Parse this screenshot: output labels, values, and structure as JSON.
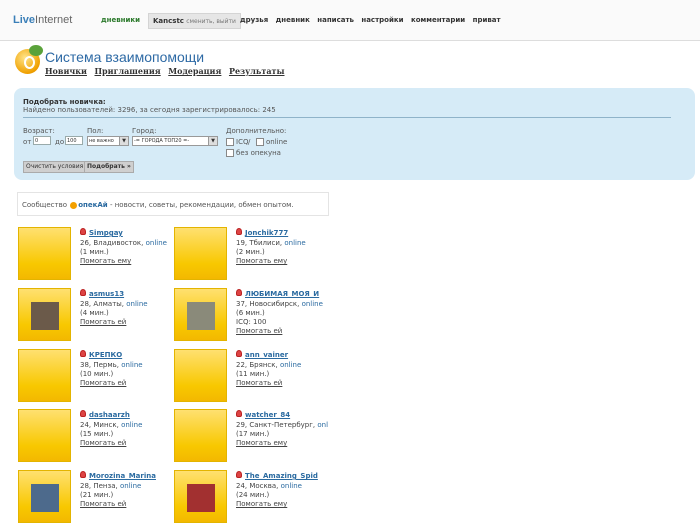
{
  "topbar": {
    "logo_a": "Live",
    "logo_b": "Internet",
    "diaries": "дневники",
    "user": "Kancstc",
    "user_actions": "сменить, выйти",
    "menu": [
      "друзья",
      "дневник",
      "написать",
      "настройки",
      "комментарии",
      "приват"
    ]
  },
  "header": {
    "title": "Система взаимопомощи",
    "nav": [
      "Новички",
      "Приглашения",
      "Модерация",
      "Результаты"
    ]
  },
  "search": {
    "title": "Подобрать новичка:",
    "stats": "Найдено пользователей: 3296, за сегодня зарегистрировалось: 245",
    "age_label": "Возраст:",
    "age_from_label": "от",
    "age_from": "0",
    "age_to_label": "до",
    "age_to": "100",
    "sex_label": "Пол:",
    "sex_value": "не важно",
    "city_label": "Город:",
    "city_value": "-= ГОРОДА ТОП20 =-",
    "extra_label": "Дополнительно:",
    "icq_label": "ICQ",
    "online_label": "online",
    "slash": "/",
    "no_guardian_label": "без опекуна",
    "clear_button": "Очистить условия",
    "submit_button": "Подобрать »"
  },
  "community": {
    "prefix": "Сообщество",
    "name": "опекАй",
    "suffix": "- новости, советы, рекомендации, обмен опытом."
  },
  "users": [
    {
      "name": "Simpgay",
      "info": "26, Владивосток,",
      "status": "online",
      "time": "(1 мин.)",
      "extra": "",
      "help": "Помогать ему",
      "photo": false
    },
    {
      "name": "Jonchik777",
      "info": "19, Тбилиси,",
      "status": "online",
      "time": "(2 мин.)",
      "extra": "",
      "help": "Помогать ему",
      "photo": false
    },
    {
      "name": "asmus13",
      "info": "28, Алматы,",
      "status": "online",
      "time": "(4 мин.)",
      "extra": "",
      "help": "Помогать ей",
      "photo": true
    },
    {
      "name": "ЛЮБИМАЯ_МОЯ_И",
      "info": "37, Новосибирск,",
      "status": "online",
      "time": "(6 мин.)",
      "extra": "ICQ: 100",
      "help": "Помогать ей",
      "photo": true
    },
    {
      "name": "КРЕПКО",
      "info": "38, Пермь,",
      "status": "online",
      "time": "(10 мин.)",
      "extra": "",
      "help": "Помогать ей",
      "photo": false
    },
    {
      "name": "ann_vainer",
      "info": "22, Брянск,",
      "status": "online",
      "time": "(11 мин.)",
      "extra": "",
      "help": "Помогать ей",
      "photo": false
    },
    {
      "name": "dashaarzh",
      "info": "24, Минск,",
      "status": "online",
      "time": "(15 мин.)",
      "extra": "",
      "help": "Помогать ей",
      "photo": false
    },
    {
      "name": "watcher_84",
      "info": "29, Санкт-Петербург,",
      "status": "onl",
      "time": "(17 мин.)",
      "extra": "",
      "help": "Помогать ему",
      "photo": false
    },
    {
      "name": "Morozina_Marina",
      "info": "28, Пенза,",
      "status": "online",
      "time": "(21 мин.)",
      "extra": "",
      "help": "Помогать ей",
      "photo": true
    },
    {
      "name": "The_Amazing_Spid",
      "info": "24, Москва,",
      "status": "online",
      "time": "(24 мин.)",
      "extra": "",
      "help": "Помогать ему",
      "photo": true
    }
  ],
  "colors": {
    "link": "#2a6aa0",
    "panel": "#d6ebf7",
    "photo_bg": "#f8c800",
    "title": "#2e6aa5"
  }
}
